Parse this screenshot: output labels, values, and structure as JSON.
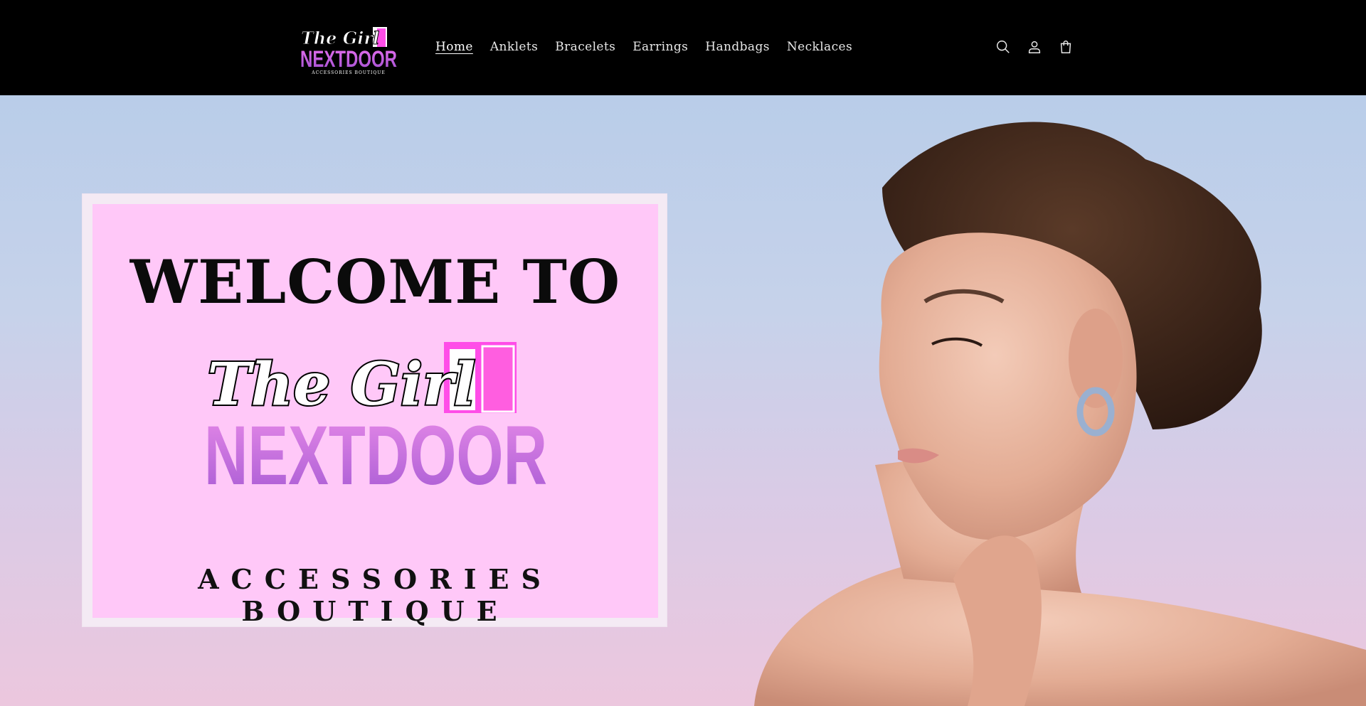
{
  "store": {
    "logo_script": "The Girl",
    "logo_name": "NEXTDOOR",
    "logo_tagline": "ACCESSORIES BOUTIQUE"
  },
  "nav": {
    "items": [
      {
        "label": "Home",
        "active": true
      },
      {
        "label": "Anklets",
        "active": false
      },
      {
        "label": "Bracelets",
        "active": false
      },
      {
        "label": "Earrings",
        "active": false
      },
      {
        "label": "Handbags",
        "active": false
      },
      {
        "label": "Necklaces",
        "active": false
      }
    ]
  },
  "header_icons": [
    "search-icon",
    "account-icon",
    "cart-icon"
  ],
  "hero": {
    "welcome": "WELCOME TO",
    "logo_script": "The Girl",
    "logo_name": "NEXTDOOR",
    "subtitle": "ACCESSORIES BOUTIQUE"
  },
  "colors": {
    "header_bg": "#000000",
    "card_bg": "#ffc8f8",
    "brand_purple": "#b05ad8",
    "brand_pink": "#ff4de8"
  }
}
